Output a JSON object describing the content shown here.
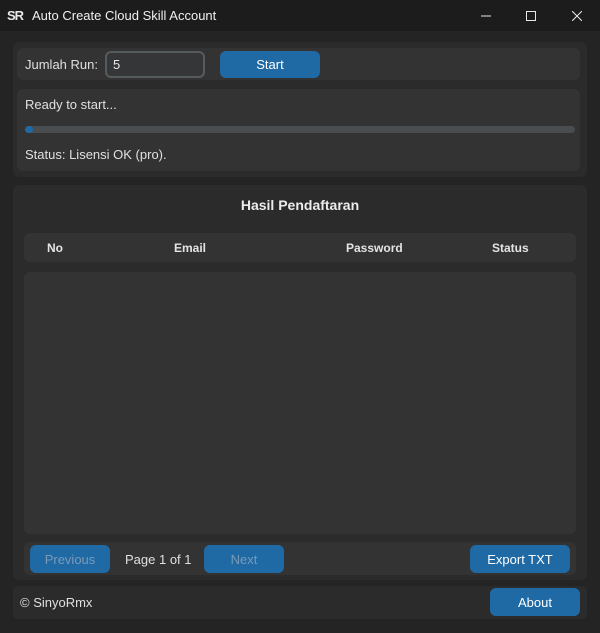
{
  "window": {
    "title": "Auto Create Cloud Skill Account",
    "logo_text": "SR"
  },
  "controls": {
    "jumlah_run_label": "Jumlah Run:",
    "jumlah_run_value": "5",
    "start_label": "Start"
  },
  "status": {
    "ready_text": "Ready to start...",
    "progress_fraction": 0.015,
    "status_text": "Status: Lisensi OK (pro)."
  },
  "results": {
    "title": "Hasil Pendaftaran",
    "columns": [
      "No",
      "Email",
      "Password",
      "Status"
    ],
    "rows": []
  },
  "pagination": {
    "previous_label": "Previous",
    "page_text": "Page 1 of 1",
    "next_label": "Next",
    "export_label": "Export TXT"
  },
  "footer": {
    "copyright": "© SinyoRmx",
    "about_label": "About"
  },
  "colors": {
    "accent": "#1f6aa5",
    "background": "#242424",
    "panel": "#2b2b2b"
  }
}
